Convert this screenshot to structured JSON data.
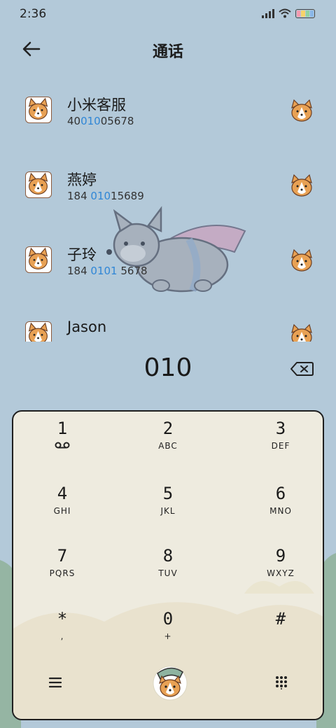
{
  "status_bar": {
    "time": "2:36"
  },
  "header": {
    "title": "通话"
  },
  "contacts": [
    {
      "name": "小米客服",
      "number_parts": [
        "40",
        "010",
        "05678"
      ]
    },
    {
      "name": "燕婷",
      "number_parts": [
        "184 ",
        "010",
        "15689"
      ]
    },
    {
      "name": "子玲",
      "number_parts": [
        "184 ",
        "0101",
        " 5678"
      ]
    },
    {
      "name": "Jason",
      "number_parts": [
        "",
        "",
        ""
      ]
    }
  ],
  "dialed_number": "010",
  "keypad": [
    {
      "digit": "1",
      "letters": ""
    },
    {
      "digit": "2",
      "letters": "ABC"
    },
    {
      "digit": "3",
      "letters": "DEF"
    },
    {
      "digit": "4",
      "letters": "GHI"
    },
    {
      "digit": "5",
      "letters": "JKL"
    },
    {
      "digit": "6",
      "letters": "MNO"
    },
    {
      "digit": "7",
      "letters": "PQRS"
    },
    {
      "digit": "8",
      "letters": "TUV"
    },
    {
      "digit": "9",
      "letters": "WXYZ"
    },
    {
      "digit": "*",
      "letters": ","
    },
    {
      "digit": "0",
      "letters": "+"
    },
    {
      "digit": "#",
      "letters": ""
    }
  ],
  "colors": {
    "background": "#b3c9d9",
    "keypad_bg": "#eeebdf",
    "highlight": "#2f86d6",
    "corgi_orange": "#e8a154"
  },
  "icons": {
    "back": "back-arrow-icon",
    "delete": "backspace-icon",
    "voicemail": "voicemail-icon",
    "menu": "menu-icon",
    "dial": "corgi-dial-icon",
    "keypad_toggle": "keypad-grid-icon"
  }
}
